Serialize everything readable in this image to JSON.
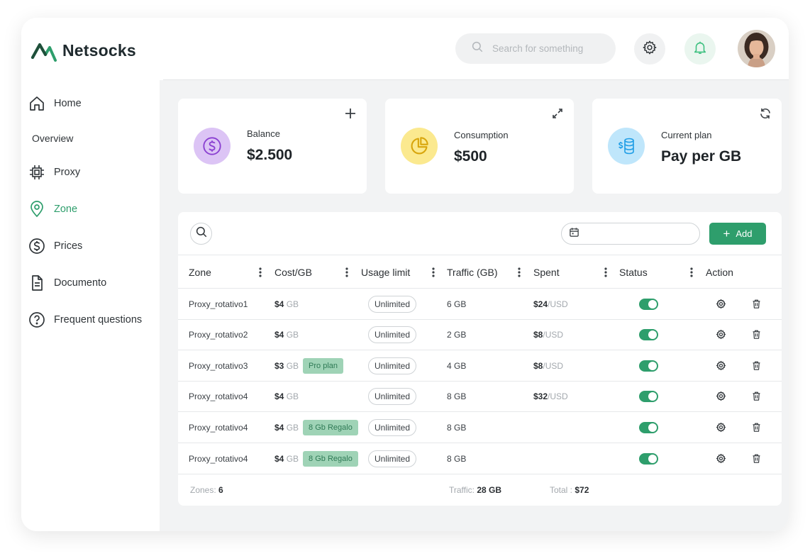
{
  "brand": {
    "name": "Netsocks",
    "accent": "#2e9e6c"
  },
  "search": {
    "placeholder": "Search for something"
  },
  "sidebar": {
    "items": [
      {
        "label": "Home",
        "icon": "home-icon"
      },
      {
        "label": "Overview"
      },
      {
        "label": "Proxy",
        "icon": "cpu-icon"
      },
      {
        "label": "Zone",
        "icon": "map-pin-icon",
        "active": true
      },
      {
        "label": "Prices",
        "icon": "dollar-circle-icon"
      },
      {
        "label": "Documento",
        "icon": "document-icon"
      },
      {
        "label": "Frequent questions",
        "icon": "question-circle-icon"
      }
    ]
  },
  "cards": {
    "balance": {
      "label": "Balance",
      "value": "$2.500",
      "action_icon": "plus-icon"
    },
    "consumption": {
      "label": "Consumption",
      "value": "$500",
      "action_icon": "expand-icon"
    },
    "plan": {
      "label": "Current plan",
      "value": "Pay per GB",
      "action_icon": "refresh-icon"
    }
  },
  "toolbar": {
    "add_label": "Add"
  },
  "table": {
    "columns": [
      "Zone",
      "Cost/GB",
      "Usage limit",
      "Traffic (GB)",
      "Spent",
      "Status",
      "Action"
    ],
    "rows": [
      {
        "zone": "Proxy_rotativo1",
        "cost": "$4",
        "cost_unit": "GB",
        "tag": "",
        "limit": "Unlimited",
        "traffic": "6 GB",
        "spent": "$24",
        "spent_unit": "/USD",
        "status": true
      },
      {
        "zone": "Proxy_rotativo2",
        "cost": "$4",
        "cost_unit": "GB",
        "tag": "",
        "limit": "Unlimited",
        "traffic": "2 GB",
        "spent": "$8",
        "spent_unit": "/USD",
        "status": true
      },
      {
        "zone": "Proxy_rotativo3",
        "cost": "$3",
        "cost_unit": "GB",
        "tag": "Pro plan",
        "limit": "Unlimited",
        "traffic": "4 GB",
        "spent": "$8",
        "spent_unit": "/USD",
        "status": true
      },
      {
        "zone": "Proxy_rotativo4",
        "cost": "$4",
        "cost_unit": "GB",
        "tag": "",
        "limit": "Unlimited",
        "traffic": "8 GB",
        "spent": "$32",
        "spent_unit": "/USD",
        "status": true
      },
      {
        "zone": "Proxy_rotativo4",
        "cost": "$4",
        "cost_unit": "GB",
        "tag": "8 Gb Regalo",
        "limit": "Unlimited",
        "traffic": "8 GB",
        "spent": "",
        "spent_unit": "",
        "status": true
      },
      {
        "zone": "Proxy_rotativo4",
        "cost": "$4",
        "cost_unit": "GB",
        "tag": "8 Gb Regalo",
        "limit": "Unlimited",
        "traffic": "8 GB",
        "spent": "",
        "spent_unit": "",
        "status": true
      }
    ]
  },
  "footer": {
    "zones_label": "Zones:",
    "zones_value": "6",
    "traffic_label": "Traffic:",
    "traffic_value": "28 GB",
    "total_label": "Total :",
    "total_value": "$72"
  }
}
